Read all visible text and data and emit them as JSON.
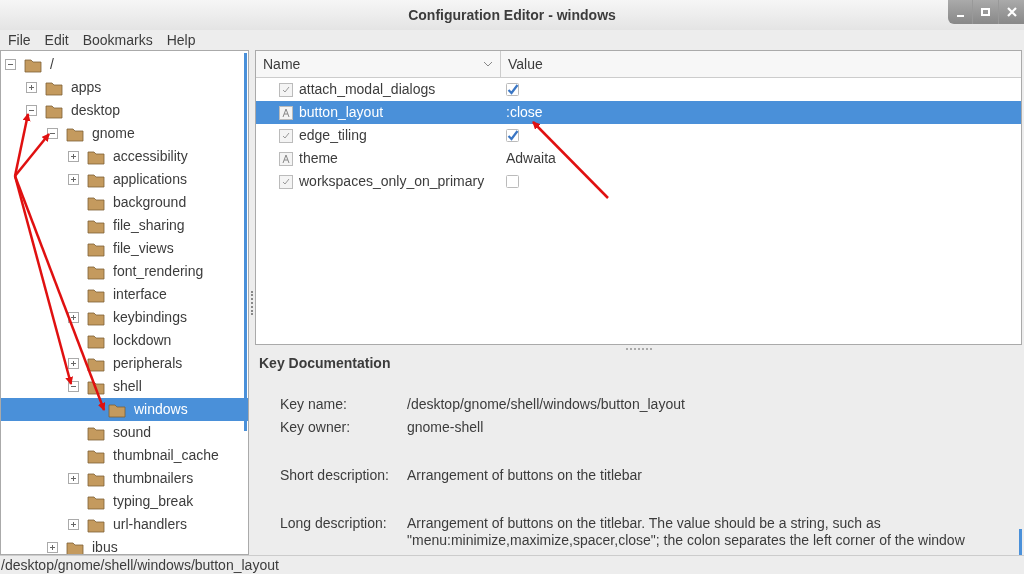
{
  "window": {
    "title": "Configuration Editor - windows"
  },
  "menu": [
    "File",
    "Edit",
    "Bookmarks",
    "Help"
  ],
  "tree": [
    {
      "label": "/",
      "kind": "expanded",
      "selected": false,
      "children": [
        {
          "label": "apps",
          "kind": "collapsed",
          "selected": false
        },
        {
          "label": "desktop",
          "kind": "expanded",
          "selected": false,
          "children": [
            {
              "label": "gnome",
              "kind": "expanded",
              "selected": false,
              "children": [
                {
                  "label": "accessibility",
                  "kind": "collapsed",
                  "selected": false
                },
                {
                  "label": "applications",
                  "kind": "collapsed",
                  "selected": false
                },
                {
                  "label": "background",
                  "kind": "leaf",
                  "selected": false
                },
                {
                  "label": "file_sharing",
                  "kind": "leaf",
                  "selected": false
                },
                {
                  "label": "file_views",
                  "kind": "leaf",
                  "selected": false
                },
                {
                  "label": "font_rendering",
                  "kind": "leaf",
                  "selected": false
                },
                {
                  "label": "interface",
                  "kind": "leaf",
                  "selected": false
                },
                {
                  "label": "keybindings",
                  "kind": "collapsed",
                  "selected": false
                },
                {
                  "label": "lockdown",
                  "kind": "leaf",
                  "selected": false
                },
                {
                  "label": "peripherals",
                  "kind": "collapsed",
                  "selected": false
                },
                {
                  "label": "shell",
                  "kind": "expanded",
                  "selected": false,
                  "children": [
                    {
                      "label": "windows",
                      "kind": "leaf",
                      "selected": true
                    }
                  ]
                },
                {
                  "label": "sound",
                  "kind": "leaf",
                  "selected": false
                },
                {
                  "label": "thumbnail_cache",
                  "kind": "leaf",
                  "selected": false
                },
                {
                  "label": "thumbnailers",
                  "kind": "collapsed",
                  "selected": false
                },
                {
                  "label": "typing_break",
                  "kind": "leaf",
                  "selected": false
                },
                {
                  "label": "url-handlers",
                  "kind": "collapsed",
                  "selected": false
                }
              ]
            },
            {
              "label": "ibus",
              "kind": "collapsed",
              "selected": false
            }
          ]
        }
      ]
    }
  ],
  "table": {
    "columns": [
      "Name",
      "Value"
    ],
    "rows": [
      {
        "name": "attach_modal_dialogs",
        "kind": "bool",
        "checked": true,
        "selected": false
      },
      {
        "name": "button_layout",
        "kind": "string",
        "value": ":close",
        "selected": true
      },
      {
        "name": "edge_tiling",
        "kind": "bool",
        "checked": true,
        "selected": false
      },
      {
        "name": "theme",
        "kind": "string",
        "value": "Adwaita",
        "selected": false
      },
      {
        "name": "workspaces_only_on_primary",
        "kind": "bool",
        "checked": false,
        "selected": false
      }
    ]
  },
  "documentation": {
    "title": "Key Documentation",
    "groups": [
      [
        {
          "label": "Key name:",
          "value": "/desktop/gnome/shell/windows/button_layout"
        },
        {
          "label": "Key owner:",
          "value": "gnome-shell"
        }
      ],
      [
        {
          "label": "Short description:",
          "value": "Arrangement of buttons on the titlebar"
        }
      ],
      [
        {
          "label": "Long description:",
          "value": "Arrangement of buttons on the titlebar. The value should be a string, such as\n\"menu:minimize,maximize,spacer,close\"; the colon separates the left corner of the window"
        }
      ]
    ]
  },
  "status_bar": "/desktop/gnome/shell/windows/button_layout"
}
